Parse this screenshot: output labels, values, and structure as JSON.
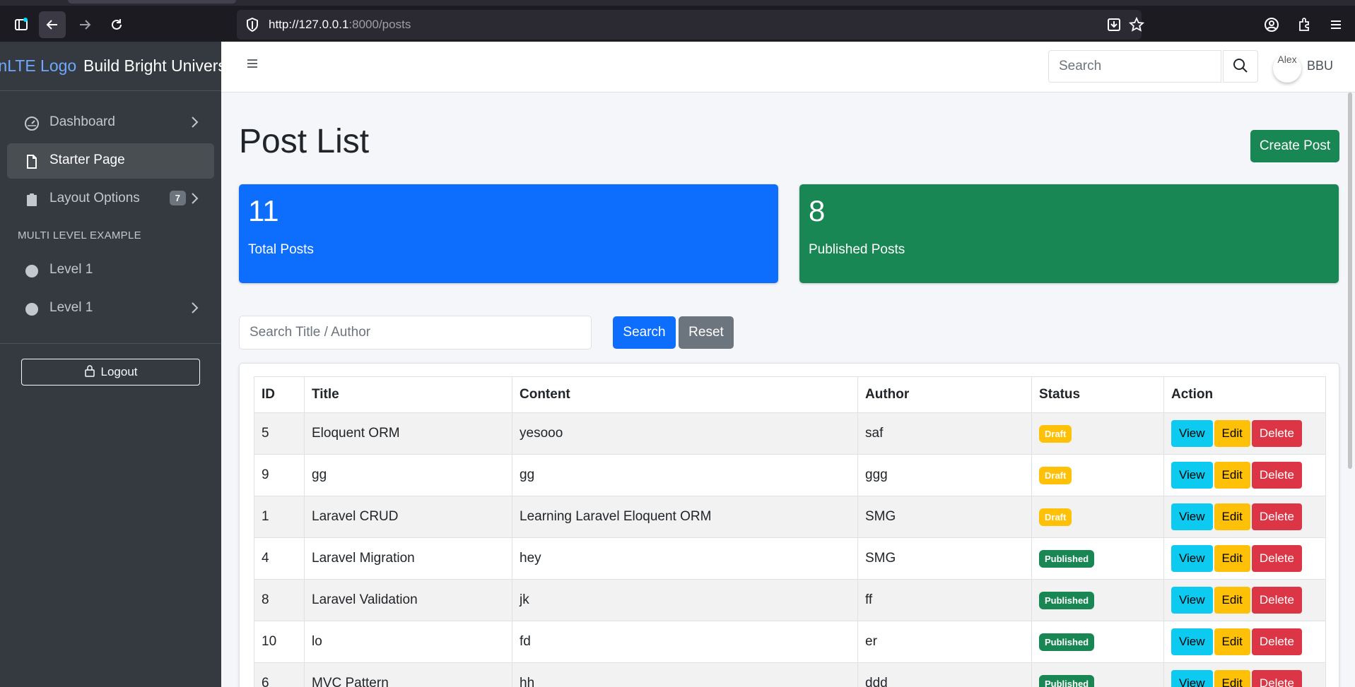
{
  "browser": {
    "url_host": "http://127.0.0.1",
    "url_path": ":8000/posts"
  },
  "sidebar": {
    "brand_logo": "AdminLTE Logo",
    "brand_name": "Build Bright Universe",
    "items": [
      {
        "label": "Dashboard"
      },
      {
        "label": "Starter Page"
      },
      {
        "label": "Layout Options",
        "badge": "7"
      }
    ],
    "section_header": "MULTI LEVEL EXAMPLE",
    "levels": [
      {
        "label": "Level 1"
      },
      {
        "label": "Level 1"
      }
    ],
    "logout_label": "Logout"
  },
  "navbar": {
    "search_placeholder": "Search",
    "avatar_text": "Alex",
    "user_name": "BBU"
  },
  "page": {
    "title": "Post List",
    "create_label": "Create Post",
    "stats": [
      {
        "value": "11",
        "label": "Total Posts",
        "color": "#0d6efd"
      },
      {
        "value": "8",
        "label": "Published Posts",
        "color": "#198754"
      }
    ],
    "filter_placeholder": "Search Title / Author",
    "search_label": "Search",
    "reset_label": "Reset"
  },
  "table": {
    "headers": [
      "ID",
      "Title",
      "Content",
      "Author",
      "Status",
      "Action"
    ],
    "actions": {
      "view": "View",
      "edit": "Edit",
      "delete": "Delete"
    },
    "rows": [
      {
        "id": "5",
        "title": "Eloquent ORM",
        "content": "yesooo",
        "author": "saf",
        "status": "Draft"
      },
      {
        "id": "9",
        "title": "gg",
        "content": "gg",
        "author": "ggg",
        "status": "Draft"
      },
      {
        "id": "1",
        "title": "Laravel CRUD",
        "content": "Learning Laravel Eloquent ORM",
        "author": "SMG",
        "status": "Draft"
      },
      {
        "id": "4",
        "title": "Laravel Migration",
        "content": "hey",
        "author": "SMG",
        "status": "Published"
      },
      {
        "id": "8",
        "title": "Laravel Validation",
        "content": "jk",
        "author": "ff",
        "status": "Published"
      },
      {
        "id": "10",
        "title": "lo",
        "content": "fd",
        "author": "er",
        "status": "Published"
      },
      {
        "id": "6",
        "title": "MVC Pattern",
        "content": "hh",
        "author": "ddd",
        "status": "Published"
      }
    ]
  }
}
